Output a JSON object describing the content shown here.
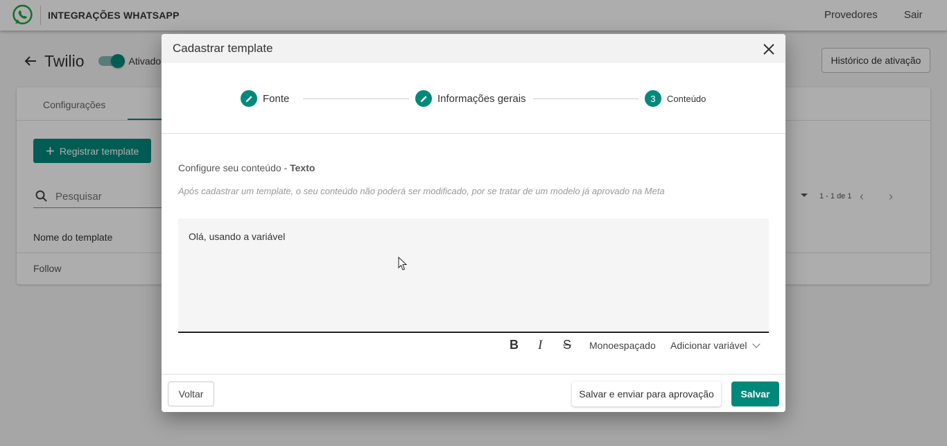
{
  "app": {
    "title": "INTEGRAÇÕES WHATSAPP",
    "nav": [
      "Provedores",
      "Sair"
    ],
    "brand_color": "#00897b"
  },
  "page": {
    "title": "Twilio",
    "toggle_label": "Ativado",
    "history_button": "Histórico de ativação",
    "tab": "Configurações",
    "register_button": "Registrar template",
    "search_placeholder": "Pesquisar",
    "column_header": "Nome do template",
    "rows": [
      "Follow"
    ],
    "pagination": "1 - 1 de 1"
  },
  "modal": {
    "title": "Cadastrar template",
    "steps": [
      {
        "label": "Fonte",
        "state": "done"
      },
      {
        "label": "Informações gerais",
        "state": "done"
      },
      {
        "number": "3",
        "label": "Conteúdo",
        "state": "active"
      }
    ],
    "content_label": "Configure seu conteúdo - ",
    "content_type": "Texto",
    "hint": "Após cadastrar um template, o seu conteúdo não poderá ser modificado, por se tratar de um modelo já aprovado na Meta",
    "editor_text": "Olá, usando a variável",
    "format": {
      "bold": "B",
      "italic": "I",
      "strike": "S",
      "mono": "Monoespaçado",
      "add_variable": "Adicionar variável"
    },
    "buttons": {
      "back": "Voltar",
      "save_send": "Salvar e enviar para aprovação",
      "save": "Salvar"
    }
  }
}
